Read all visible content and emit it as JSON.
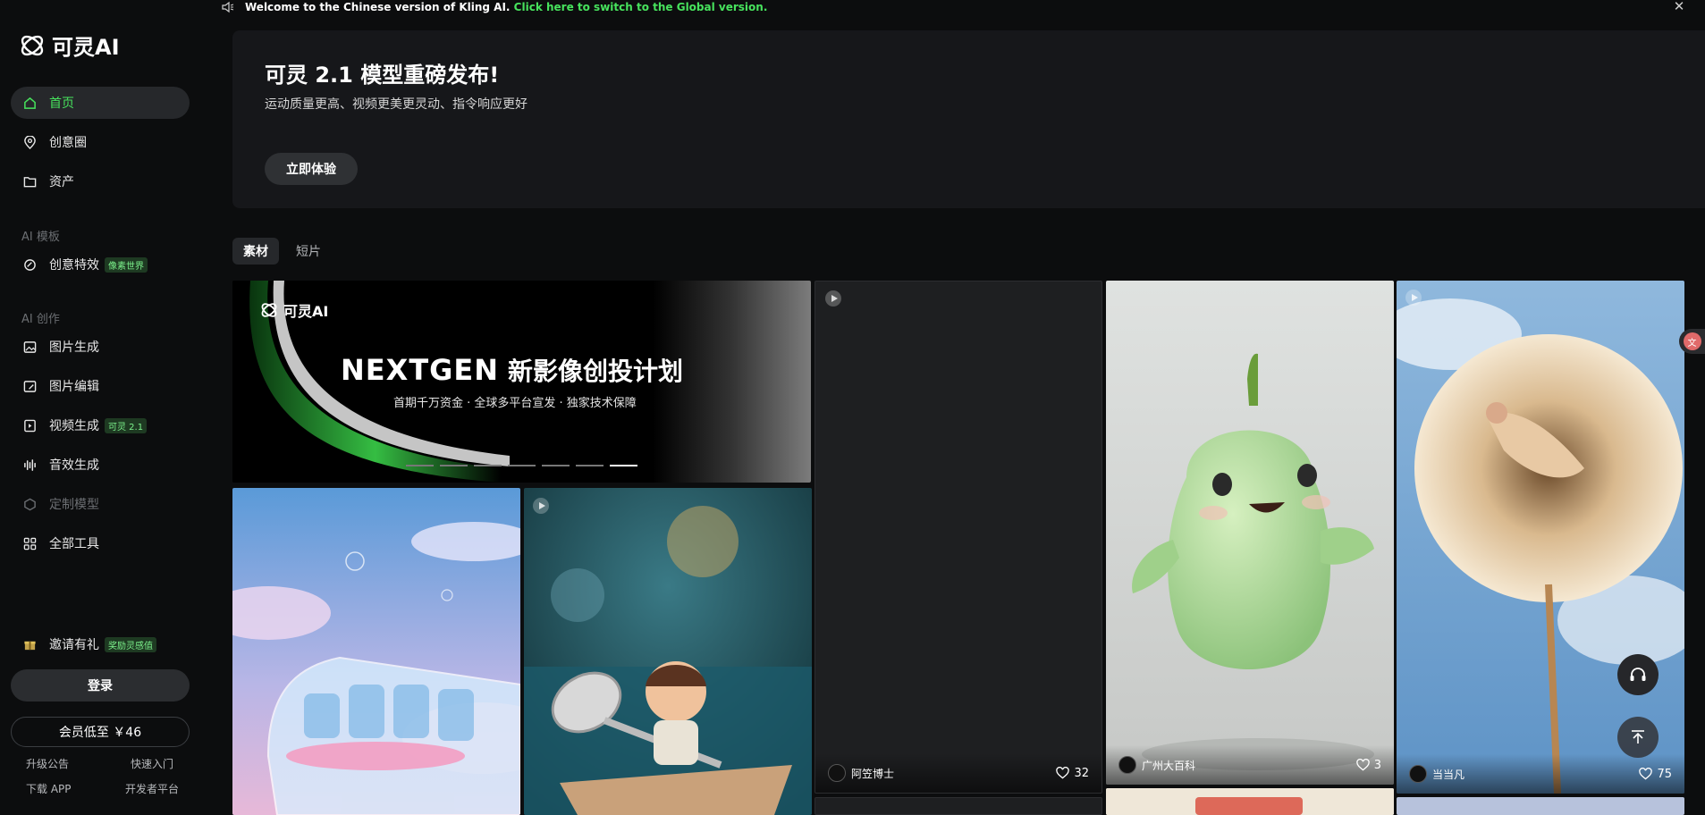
{
  "notice": {
    "text": "Welcome to the Chinese version of Kling AI.",
    "link": "Click here to switch to the Global version."
  },
  "brand": {
    "name": "可灵AI"
  },
  "nav": {
    "home": "首页",
    "creative_circle": "创意圈",
    "assets": "资产",
    "section_templates": "AI 模板",
    "effects": "创意特效",
    "effects_tag": "像素世界",
    "section_create": "AI 创作",
    "image_gen": "图片生成",
    "image_edit": "图片编辑",
    "video_gen": "视频生成",
    "video_tag": "可灵 2.1",
    "sound_gen": "音效生成",
    "custom_model": "定制模型",
    "all_tools": "全部工具"
  },
  "invite": {
    "label": "邀请有礼",
    "tag": "奖励灵感值"
  },
  "account": {
    "login": "登录",
    "member": "会员低至 ￥46"
  },
  "footer_links": {
    "upgrade": "升级公告",
    "quickstart": "快速入门",
    "download": "下载 APP",
    "developer": "开发者平台"
  },
  "banner": {
    "title": "可灵 2.1 模型重磅发布!",
    "subtitle": "运动质量更高、视频更美更灵动、指令响应更好",
    "cta": "立即体验"
  },
  "tabs": [
    "素材",
    "短片"
  ],
  "promo": {
    "logo": "可灵AI",
    "headline_en": "NEXTGEN",
    "headline_cn": "新影像创投计划",
    "sub": "首期千万资金 · 全球多平台宣发 · 独家技术保障",
    "slide_count": 7,
    "active_slide": 7
  },
  "cards": [
    {
      "author": "阿笠博士",
      "likes": "32"
    },
    {
      "author": "广州大百科",
      "likes": "3"
    },
    {
      "author": "当当凡",
      "likes": "75"
    }
  ],
  "colors": {
    "accent": "#47e35d",
    "bg": "#0c0d0e",
    "panel": "#16171a"
  },
  "icons": {
    "speaker": "speaker-icon",
    "close": "close-icon",
    "support": "headset-icon",
    "top": "back-to-top-icon",
    "like": "heart-icon",
    "play": "play-icon"
  }
}
